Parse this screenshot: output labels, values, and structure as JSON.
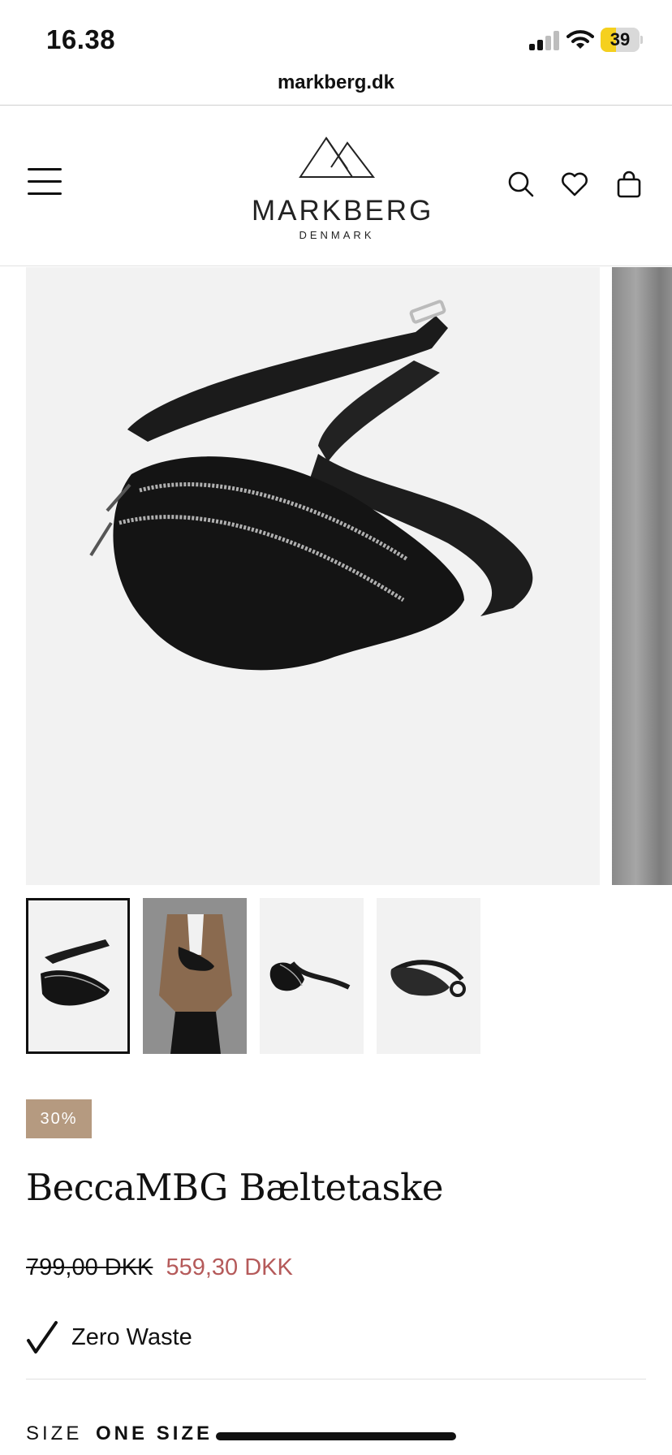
{
  "status_bar": {
    "time": "16.38",
    "battery_level": "39",
    "battery_fraction": 0.39,
    "battery_color": "#f5d01e"
  },
  "browser": {
    "url": "markberg.dk"
  },
  "header": {
    "brand": "MARKBERG",
    "brand_sub": "DENMARK",
    "icons": [
      "menu-icon",
      "search-icon",
      "heart-icon",
      "bag-icon"
    ]
  },
  "gallery": {
    "thumbnail_count": 4,
    "active_index": 0
  },
  "product": {
    "discount_badge": "30%",
    "title": "BeccaMBG Bæltetaske",
    "old_price": "799,00 DKK",
    "new_price": "559,30 DKK",
    "feature": "Zero Waste",
    "size_label": "SIZE",
    "size_value": "ONE SIZE"
  },
  "colors": {
    "badge": "#b59a80",
    "sale_price": "#b55a5a",
    "text": "#111111"
  }
}
